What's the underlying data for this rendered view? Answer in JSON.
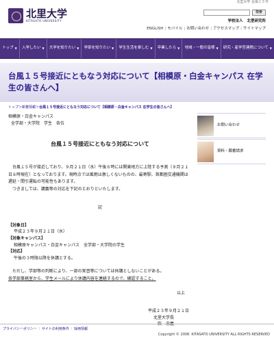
{
  "top_strip": "北里大学 台風１５号",
  "logo": {
    "jp": "北里大学",
    "en": "KITASATO UNIVERSITY"
  },
  "search": {
    "placeholder": "",
    "button": "検索"
  },
  "corp": {
    "label": "学校法人",
    "name": "北里研究所"
  },
  "utility_links": [
    "ENGLISH",
    "モバイル",
    "お問い合わせ",
    "アクセスマップ",
    "サイトマップ"
  ],
  "gnav": [
    {
      "label": "トップ"
    },
    {
      "label": "入学したい"
    },
    {
      "label": "大学を知りたい"
    },
    {
      "label": "学部を知りたい"
    },
    {
      "label": "学生生活を楽しむ"
    },
    {
      "label": "卒業したら"
    },
    {
      "label": "地域・一般の皆様"
    },
    {
      "label": "研究・産学官連携について"
    }
  ],
  "page_title": "台風１５号接近にともなう対応について【相模原・白金キャンパス 在学生の皆さんへ】",
  "breadcrumb": {
    "items": [
      "トップ",
      "新着情報"
    ],
    "current": "台風１５号接近にともなう対応について【相模原・白金キャンパス 在学生の皆さんへ】"
  },
  "sidebar": [
    {
      "label": "お問い合わせ",
      "icon": "person-photo"
    },
    {
      "label": "資料・願書請求",
      "icon": "hands-photo"
    }
  ],
  "greeting": {
    "line1": "相模原・白金キャンパス",
    "line2": "全学部・大学院　学生　各位"
  },
  "doc_title": "台風１５号接近にともなう対応について",
  "body_para1": "台風１５号が接近しており、９月２１日（水）午後６時には関東地方に上陸する予測（９月２１日８時現在）となっております。現時点では風雨は激しくないものの、最寄駅、首都圏交通機関は遅延・間引運転の可能性もあります。",
  "body_para2": "つきましては、講義等の対応を下記のとおりといたします。",
  "ki": "記",
  "details": {
    "date_head": "【対象日】",
    "date_val": "平成２３年９月２１日（水）",
    "campus_head": "【対象キャンパス】",
    "campus_val": "相模原キャンパス・白金キャンパス　全学部・大学院の学生",
    "action_head": "【対応】",
    "action_val": "午後の３時限以降を休講とする。"
  },
  "note_line1": "ただし、学部等の判断により、一部の実習等については休講としないことがある。",
  "note_line2": "各学部事務室から、学生メールにより休講内容を連絡するので、確認すること。",
  "ijo": "以上",
  "signature": {
    "date": "平成２３年９月２１日",
    "title": "北里大学長",
    "name": "柴　忠義"
  },
  "footer": {
    "links": [
      "プライバシーポリシー",
      "サイトの利用条件",
      "採用情報"
    ],
    "copyright": "Copyright © 2008. KITASATO UNIVERSITY ALL RIGHTS RESERVED"
  },
  "colors": {
    "nav": "#4b3282",
    "title": "#2f2090",
    "banner": "#dcd9ee"
  }
}
